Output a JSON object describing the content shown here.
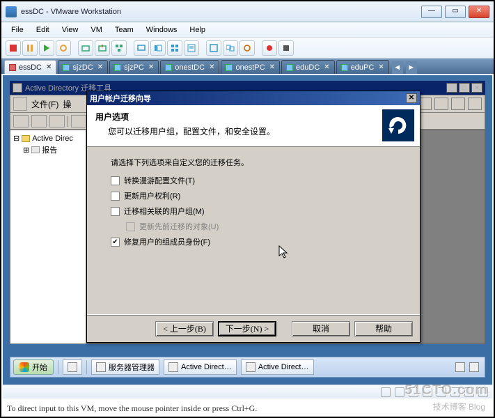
{
  "window": {
    "title": "essDC - VMware Workstation"
  },
  "menu": {
    "file": "File",
    "edit": "Edit",
    "view": "View",
    "vm": "VM",
    "team": "Team",
    "windows": "Windows",
    "help": "Help"
  },
  "tabs": [
    {
      "label": "essDC",
      "active": true
    },
    {
      "label": "sjzDC",
      "active": false
    },
    {
      "label": "sjzPC",
      "active": false
    },
    {
      "label": "onestDC",
      "active": false
    },
    {
      "label": "onestPC",
      "active": false
    },
    {
      "label": "eduDC",
      "active": false
    },
    {
      "label": "eduPC",
      "active": false
    }
  ],
  "ad_window": {
    "title": "Active Directory 迁移工具",
    "file_menu": "文件(F)",
    "other": "操"
  },
  "tree": {
    "root": "Active Direc",
    "report": "报告"
  },
  "wizard": {
    "title": "用户帐户迁移向导",
    "head_title": "用户选项",
    "head_sub": "您可以迁移用户组，配置文件，和安全设置。",
    "intro": "请选择下列选项来自定义您的迁移任务。",
    "opt1": "转换漫游配置文件(T)",
    "opt2": "更新用户权利(R)",
    "opt3": "迁移相关联的用户组(M)",
    "opt3a": "更新先前迁移的对象(U)",
    "opt4": "修复用户的组成员身份(F)",
    "back": "< 上一步(B)",
    "next": "下一步(N) >",
    "cancel": "取消",
    "help": "帮助"
  },
  "taskbar": {
    "start": "开始",
    "items": [
      "服务器管理器",
      "Active Direct…",
      "Active Direct…"
    ]
  },
  "statusbar_hint": "To direct input to this VM, move the mouse pointer inside or press Ctrl+G.",
  "watermark": "51CTO.com",
  "watermark2": "技术博客  Blog"
}
